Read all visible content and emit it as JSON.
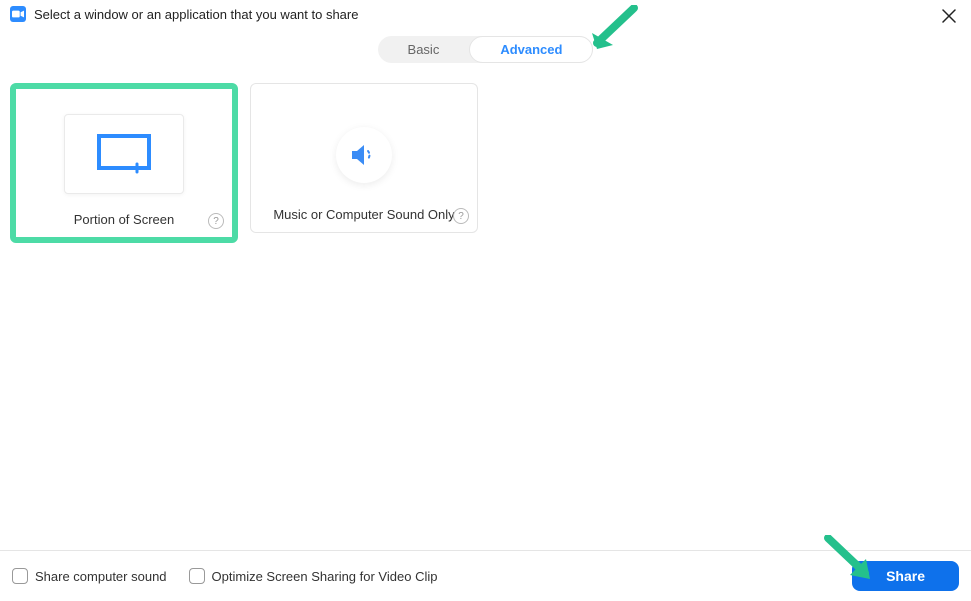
{
  "header": {
    "title": "Select a window or an application that you want to share"
  },
  "tabs": {
    "basic": "Basic",
    "advanced": "Advanced"
  },
  "options": {
    "portion": {
      "label": "Portion of Screen"
    },
    "music": {
      "label": "Music or Computer Sound Only"
    }
  },
  "footer": {
    "share_sound": "Share computer sound",
    "optimize_video": "Optimize Screen Sharing for Video Clip",
    "share": "Share"
  }
}
